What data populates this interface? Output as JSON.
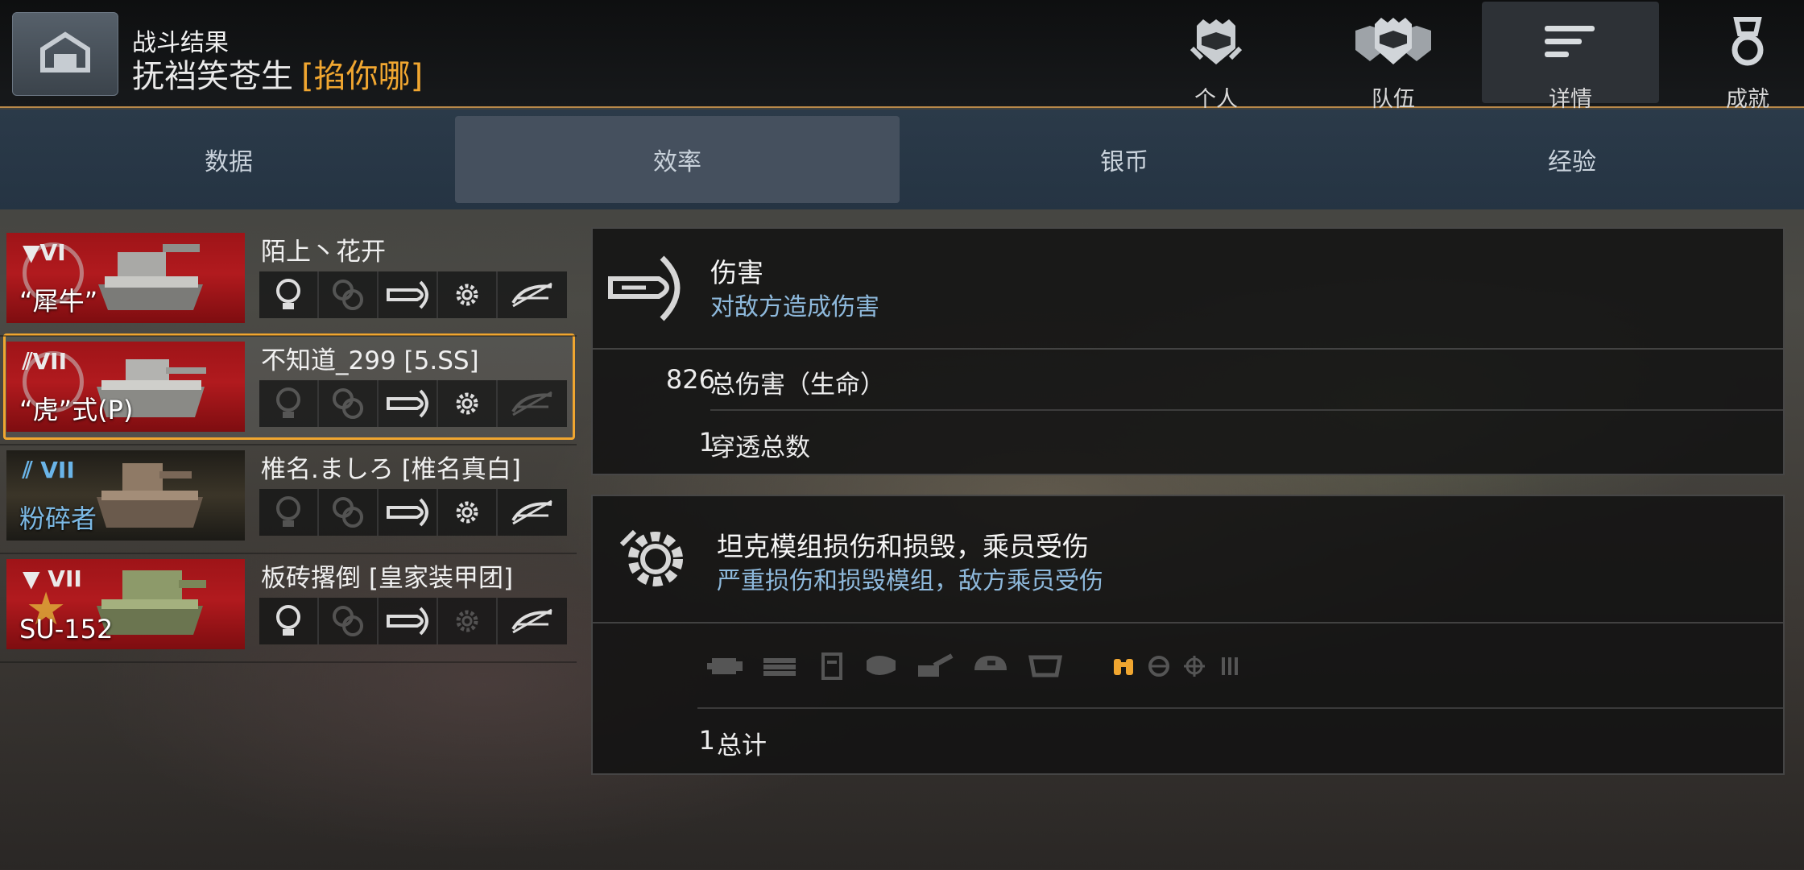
{
  "header": {
    "subtitle": "战斗结果",
    "player_name": "抚裆笑苍生",
    "clan_tag": "[掐你哪]"
  },
  "top_nav": [
    {
      "label": "个人",
      "icon": "helmet-icon",
      "active": false
    },
    {
      "label": "队伍",
      "icon": "team-helmets-icon",
      "active": false
    },
    {
      "label": "详情",
      "icon": "details-lines-icon",
      "active": true
    },
    {
      "label": "成就",
      "icon": "medal-icon",
      "active": false
    }
  ],
  "tabs": [
    {
      "label": "数据",
      "active": false
    },
    {
      "label": "效率",
      "active": true
    },
    {
      "label": "银币",
      "active": false
    },
    {
      "label": "经验",
      "active": false
    }
  ],
  "players": [
    {
      "player": "陌上丶花开",
      "tank": "“犀牛”",
      "tier": "VI",
      "card_style": "red",
      "selected": false,
      "icons": [
        {
          "name": "spotting-bulb-icon",
          "active": true
        },
        {
          "name": "assist-icon",
          "active": false
        },
        {
          "name": "shell-damage-icon",
          "active": true
        },
        {
          "name": "module-gear-icon",
          "active": true
        },
        {
          "name": "block-armor-icon",
          "active": true
        }
      ]
    },
    {
      "player": "不知道_299 [5.SS]",
      "tank": "“虎”式(P)",
      "tier": "VII",
      "card_style": "red",
      "selected": true,
      "icons": [
        {
          "name": "spotting-bulb-icon",
          "active": false
        },
        {
          "name": "assist-icon",
          "active": false
        },
        {
          "name": "shell-damage-icon",
          "active": true
        },
        {
          "name": "module-gear-icon",
          "active": true
        },
        {
          "name": "block-armor-icon",
          "active": false
        }
      ]
    },
    {
      "player": "椎名.ましろ [椎名真白]",
      "tank": "粉碎者",
      "tier": "VII",
      "card_style": "dark",
      "selected": false,
      "icons": [
        {
          "name": "spotting-bulb-icon",
          "active": false
        },
        {
          "name": "assist-icon",
          "active": false
        },
        {
          "name": "shell-damage-icon",
          "active": true
        },
        {
          "name": "module-gear-icon",
          "active": true
        },
        {
          "name": "block-armor-icon",
          "active": true
        }
      ]
    },
    {
      "player": "板砖撂倒 [皇家装甲团]",
      "tank": "SU-152",
      "tier": "VII",
      "card_style": "red",
      "selected": false,
      "icons": [
        {
          "name": "spotting-bulb-icon",
          "active": true
        },
        {
          "name": "assist-icon",
          "active": false
        },
        {
          "name": "shell-damage-icon",
          "active": true
        },
        {
          "name": "module-gear-icon",
          "active": false
        },
        {
          "name": "block-armor-icon",
          "active": true
        }
      ]
    }
  ],
  "damage_panel": {
    "title": "伤害",
    "description": "对敌方造成伤害",
    "rows": [
      {
        "value": "826",
        "label": "总伤害（生命）"
      },
      {
        "value": "1",
        "label": "穿透总数"
      }
    ]
  },
  "module_panel": {
    "title": "坦克模组损伤和损毁，乘员受伤",
    "description": "严重损伤和损毁模组，敌方乘员受伤",
    "module_icons": [
      {
        "name": "engine-icon",
        "active": false
      },
      {
        "name": "track-icon",
        "active": false
      },
      {
        "name": "fuel-tank-icon",
        "active": false
      },
      {
        "name": "ammo-rack-icon",
        "active": false
      },
      {
        "name": "gun-icon",
        "active": false
      },
      {
        "name": "turret-icon",
        "active": false
      },
      {
        "name": "radio-icon",
        "active": false
      }
    ],
    "crew_icons": [
      {
        "name": "commander-binoculars-icon",
        "active": true,
        "color": "#f0a630"
      },
      {
        "name": "driver-wheel-icon",
        "active": false
      },
      {
        "name": "gunner-sight-icon",
        "active": false
      },
      {
        "name": "loader-shells-icon",
        "active": false
      }
    ],
    "total": {
      "value": "1",
      "label": "总计"
    }
  },
  "colors": {
    "accent": "#f0a630",
    "description_blue": "#8eb9dc",
    "tab_active": "#45505e",
    "tab_bar": "#2b3a49"
  }
}
